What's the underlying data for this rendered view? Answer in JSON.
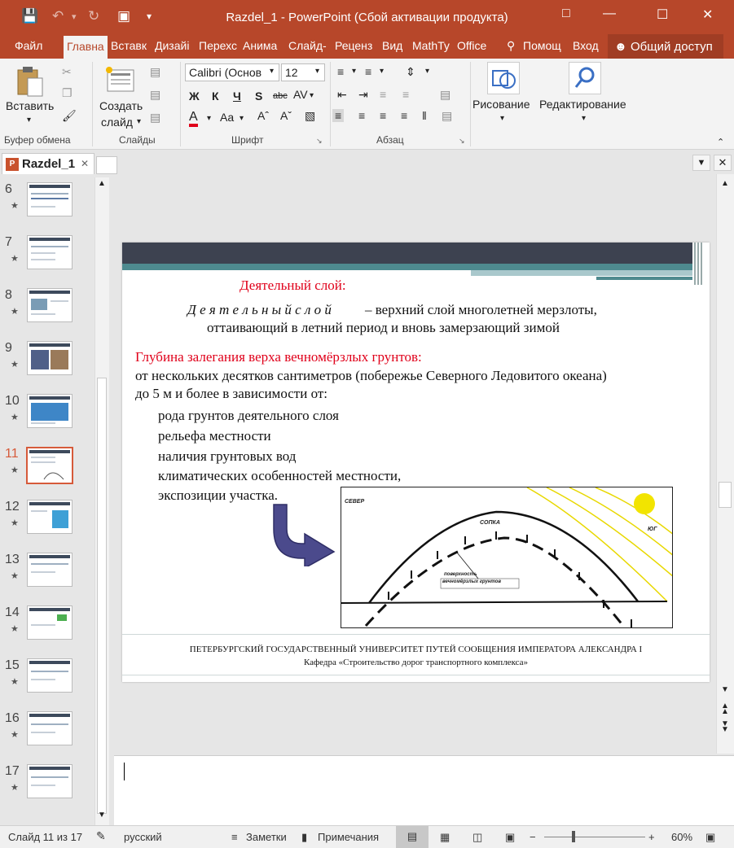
{
  "window": {
    "title": "Razdel_1 - PowerPoint (Сбой активации продукта)"
  },
  "tabs": [
    "Файл",
    "Главна",
    "Вставк",
    "Дизайі",
    "Перехс",
    "Анима",
    "Слайд-",
    "Реценз",
    "Вид",
    "MathTy",
    "Office"
  ],
  "tab_help": "Помощ",
  "tab_login": "Вход",
  "share_label": "Общий доступ",
  "ribbon": {
    "paste_label": "Вставить",
    "create_label1": "Создать",
    "create_label2": "слайд",
    "font_name": "Calibri (Основ",
    "font_size": "12",
    "draw_label": "Рисование",
    "edit_label": "Редактирование",
    "groups": [
      "Буфер обмена",
      "Слайды",
      "Шрифт",
      "Абзац"
    ],
    "fmt_bold": "Ж",
    "fmt_italic": "К",
    "fmt_underline": "Ч",
    "fmt_shadow": "S",
    "fmt_strike": "abc",
    "fmt_aa": "Aa"
  },
  "doc_tab": {
    "name": "Razdel_1",
    "icon_letter": "P"
  },
  "thumbnails": [
    {
      "num": "6"
    },
    {
      "num": "7"
    },
    {
      "num": "8"
    },
    {
      "num": "9"
    },
    {
      "num": "10"
    },
    {
      "num": "11"
    },
    {
      "num": "12"
    },
    {
      "num": "13"
    },
    {
      "num": "14"
    },
    {
      "num": "15"
    },
    {
      "num": "16"
    },
    {
      "num": "17"
    }
  ],
  "selected_slide": 11,
  "slide": {
    "heading": "Деятельный слой:",
    "term": "Д е я т е л ь н ы й   с л о й",
    "definition_rest": " – верхний слой многолетней мерзлоты,",
    "definition_line2": "оттаивающий в летний период и вновь замерзающий зимой",
    "depth_heading": "Глубина залегания верха вечномёрзлых грунтов:",
    "depth_line1": "от нескольких десятков сантиметров (побережье Северного Ледовитого океана)",
    "depth_line2": "до 5 м и более в зависимости от:",
    "bullets": [
      "рода грунтов деятельного слоя",
      "рельефа местности",
      "наличия грунтовых вод",
      "климатических особенностей местности,",
      "экспозиции участка."
    ],
    "diagram": {
      "north": "СЕВЕР",
      "south": "ЮГ",
      "hill": "СОПКА",
      "surface1": "поверхность",
      "surface2": "вечномёрзлых грунтов"
    },
    "footer1": "ПЕТЕРБУРГСКИЙ ГОСУДАРСТВЕННЫЙ УНИВЕРСИТЕТ ПУТЕЙ СООБЩЕНИЯ ИМПЕРАТОРА АЛЕКСАНДРА I",
    "footer2": "Кафедра «Строительство дорог транспортного комплекса»"
  },
  "status": {
    "slide_info": "Слайд 11 из 17",
    "language": "русский",
    "notes": "Заметки",
    "comments": "Примечания",
    "zoom": "60%"
  },
  "colors": {
    "brand": "#b7472a",
    "slide_red": "#e0001a",
    "bar_dark": "#3d4250",
    "bar_teal": "#4e8a8f",
    "arrow": "#4b4a8c",
    "sun": "#f2e400"
  }
}
